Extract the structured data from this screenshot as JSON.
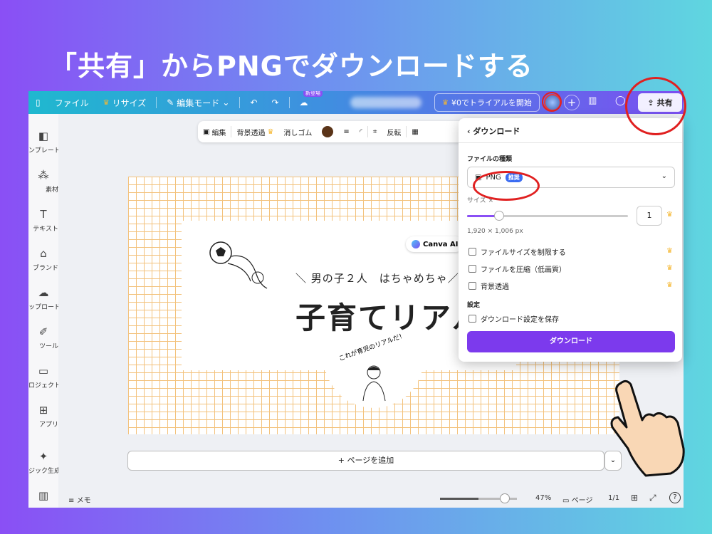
{
  "headline": "「共有」からPNGでダウンロードする",
  "topbar": {
    "file": "ファイル",
    "resize": "リサイズ",
    "edit_mode": "編集モード",
    "new_badge": "新登場",
    "trial": "¥0でトライアルを開始",
    "share": "共有"
  },
  "sidebar": [
    {
      "label": "ンプレート"
    },
    {
      "label": "素材"
    },
    {
      "label": "テキスト"
    },
    {
      "label": "ブランド"
    },
    {
      "label": "ップロード"
    },
    {
      "label": "ツール"
    },
    {
      "label": "ロジェクト"
    },
    {
      "label": "アプリ"
    },
    {
      "label": "ジック生成"
    }
  ],
  "edit_toolbar": {
    "edit": "編集",
    "bg_transparent": "背景透過",
    "eraser": "消しゴム",
    "flip": "反転"
  },
  "design": {
    "subtitle": "＼ 男の子２人　はちゃめちゃ／",
    "title": "子育てリアルn",
    "arc_text": "これが育児のリアルだ！",
    "ai_chip": "Canva AI"
  },
  "add_page": "+ ページを追加",
  "bottombar": {
    "memo": "メモ",
    "zoom": "47%",
    "pages": "ページ",
    "page_count": "1/1"
  },
  "download_panel": {
    "back": "ダウンロード",
    "file_type_label": "ファイルの種類",
    "file_type": "PNG",
    "recommended": "推奨",
    "size_label": "サイズ ×",
    "size_value": "1",
    "dimensions": "1,920 × 1,006 px",
    "options": [
      {
        "label": "ファイルサイズを制限する"
      },
      {
        "label": "ファイルを圧縮（低画質）"
      },
      {
        "label": "背景透過"
      }
    ],
    "settings_label": "設定",
    "save_settings": "ダウンロード設定を保存",
    "download_button": "ダウンロード"
  }
}
